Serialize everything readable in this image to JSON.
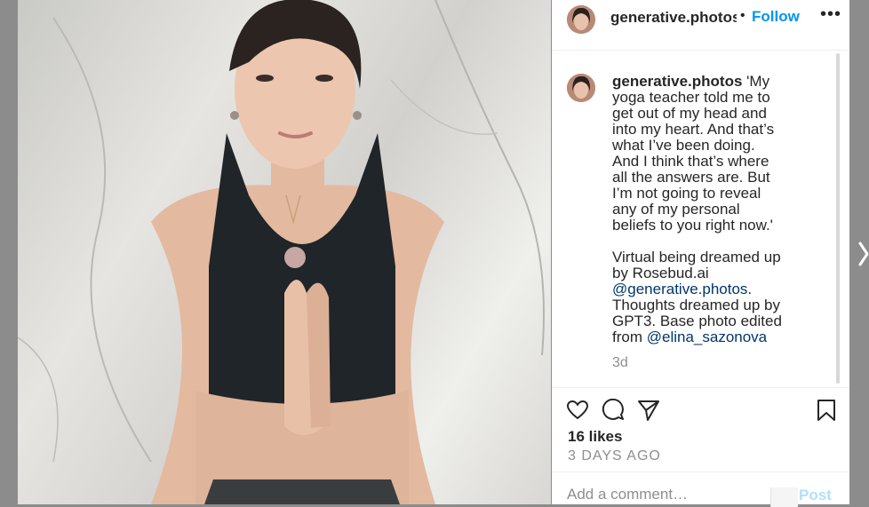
{
  "post": {
    "username": "generative.photos",
    "follow_label": "Follow",
    "separator": "•",
    "more_icon": "more-horizontal-icon",
    "caption_lines_1": "'My\nyoga teacher told me to\nget out of my head and\ninto my heart. And that’s\nwhat I’ve been doing.\nAnd I think that’s where\nall the answers are. But\nI’m not going to reveal\nany of my personal\nbeliefs to you right now.'\n\nVirtual being dreamed up\nby Rosebud.ai\n",
    "mention_1": "@generative.photos",
    "caption_lines_2": ".\nThoughts dreamed up by\nGPT3. Base photo edited\nfrom ",
    "mention_2": "@elina_sazonova",
    "comment_time": "3d",
    "likes": "16 likes",
    "posted_ago": "3 DAYS AGO",
    "comment_placeholder": "Add a comment…",
    "post_label": "Post"
  },
  "icons": {
    "like": "heart-icon",
    "comment": "comment-bubble-icon",
    "share": "paper-plane-icon",
    "save": "bookmark-icon",
    "next": "chevron-right-icon"
  },
  "colors": {
    "accent": "#0095f6",
    "post_disabled": "#b2dffc",
    "mention": "#00376b",
    "text": "#262626",
    "muted": "#8e8e8e"
  }
}
